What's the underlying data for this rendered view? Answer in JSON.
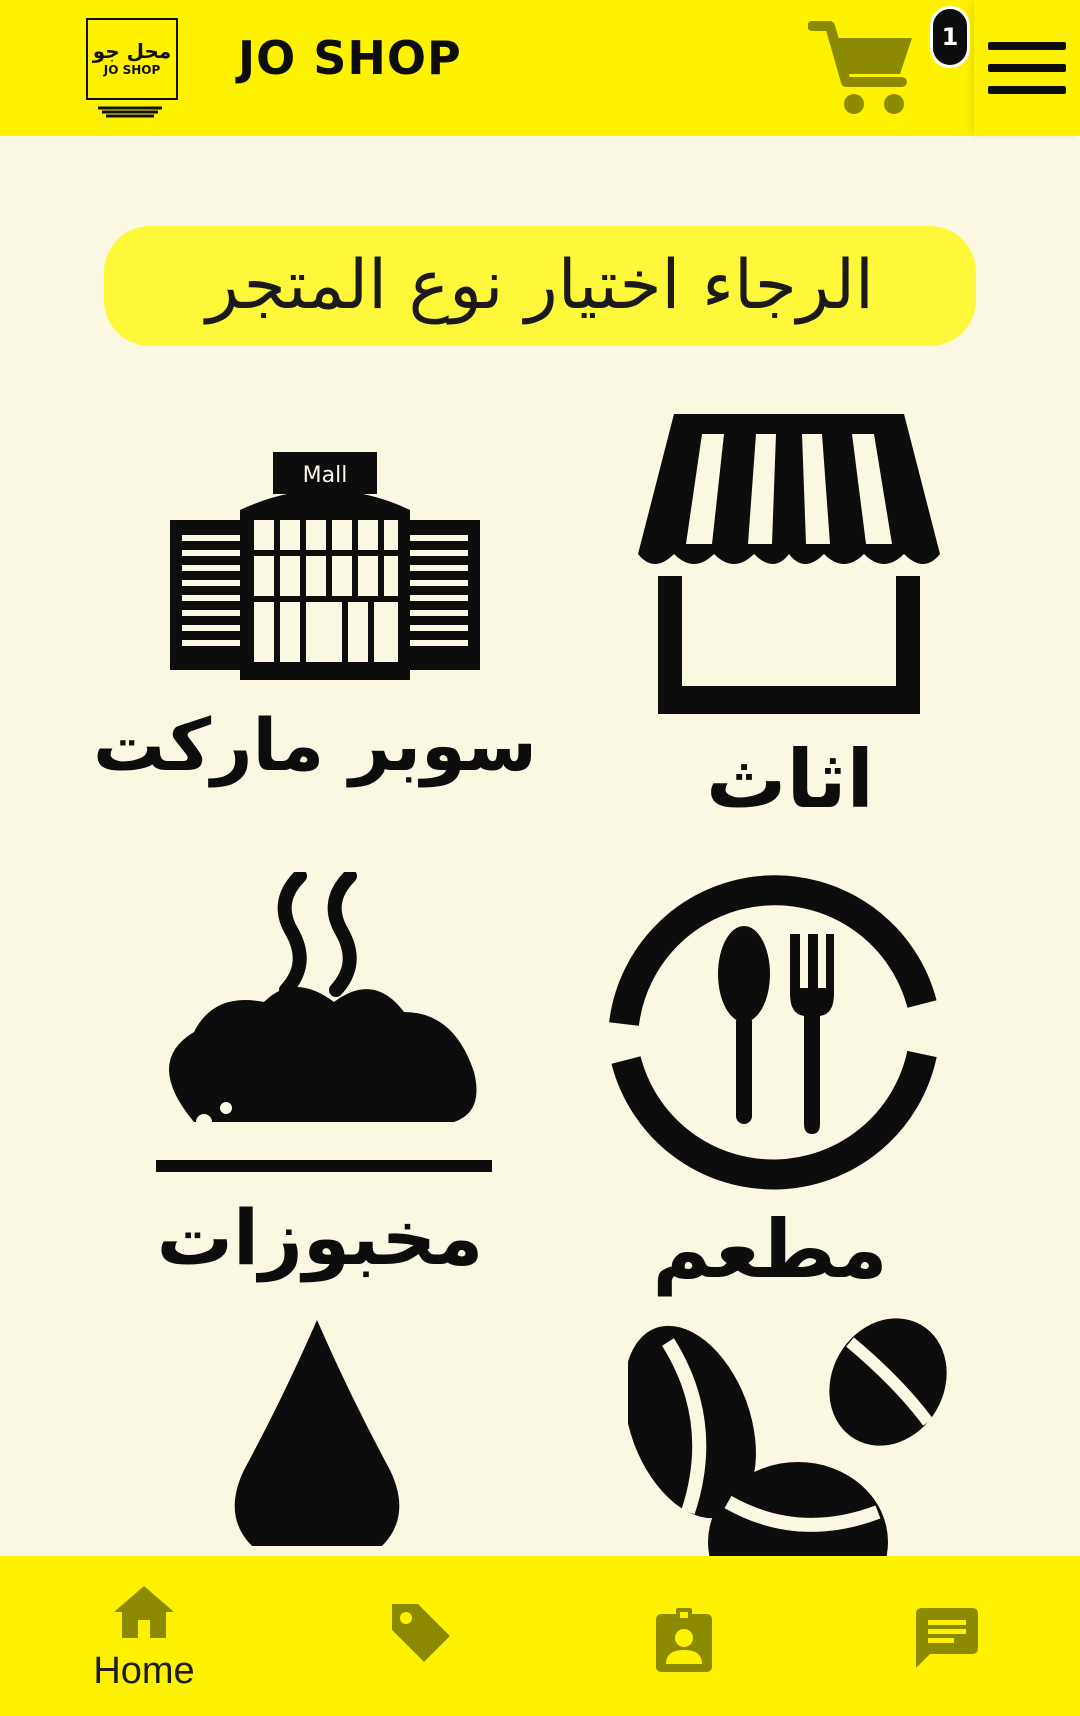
{
  "header": {
    "logo_ar": "محل جو",
    "logo_en": "JO SHOP",
    "brand_title": "JO SHOP",
    "cart_count": "1"
  },
  "banner": {
    "text": "الرجاء اختيار نوع المتجر"
  },
  "categories": [
    {
      "label": "سوبر ماركت",
      "icon": "mall-icon",
      "icon_text": "Mall"
    },
    {
      "label": "اثاث",
      "icon": "storefront-icon"
    },
    {
      "label": "مخبوزات",
      "icon": "bread-icon"
    },
    {
      "label": "مطعم",
      "icon": "restaurant-icon"
    },
    {
      "label": "",
      "icon": "drop-icon"
    },
    {
      "label": "",
      "icon": "coffee-beans-icon"
    }
  ],
  "bottom_nav": {
    "items": [
      {
        "label": "Home",
        "icon": "home-icon",
        "active": true
      },
      {
        "label": "",
        "icon": "tag-icon"
      },
      {
        "label": "",
        "icon": "contact-badge-icon"
      },
      {
        "label": "",
        "icon": "chat-icon"
      }
    ]
  },
  "colors": {
    "primary": "#FFF200",
    "background": "#FAF8E2",
    "icon_olive": "#8C8A00",
    "banner": "#FFF73A"
  }
}
